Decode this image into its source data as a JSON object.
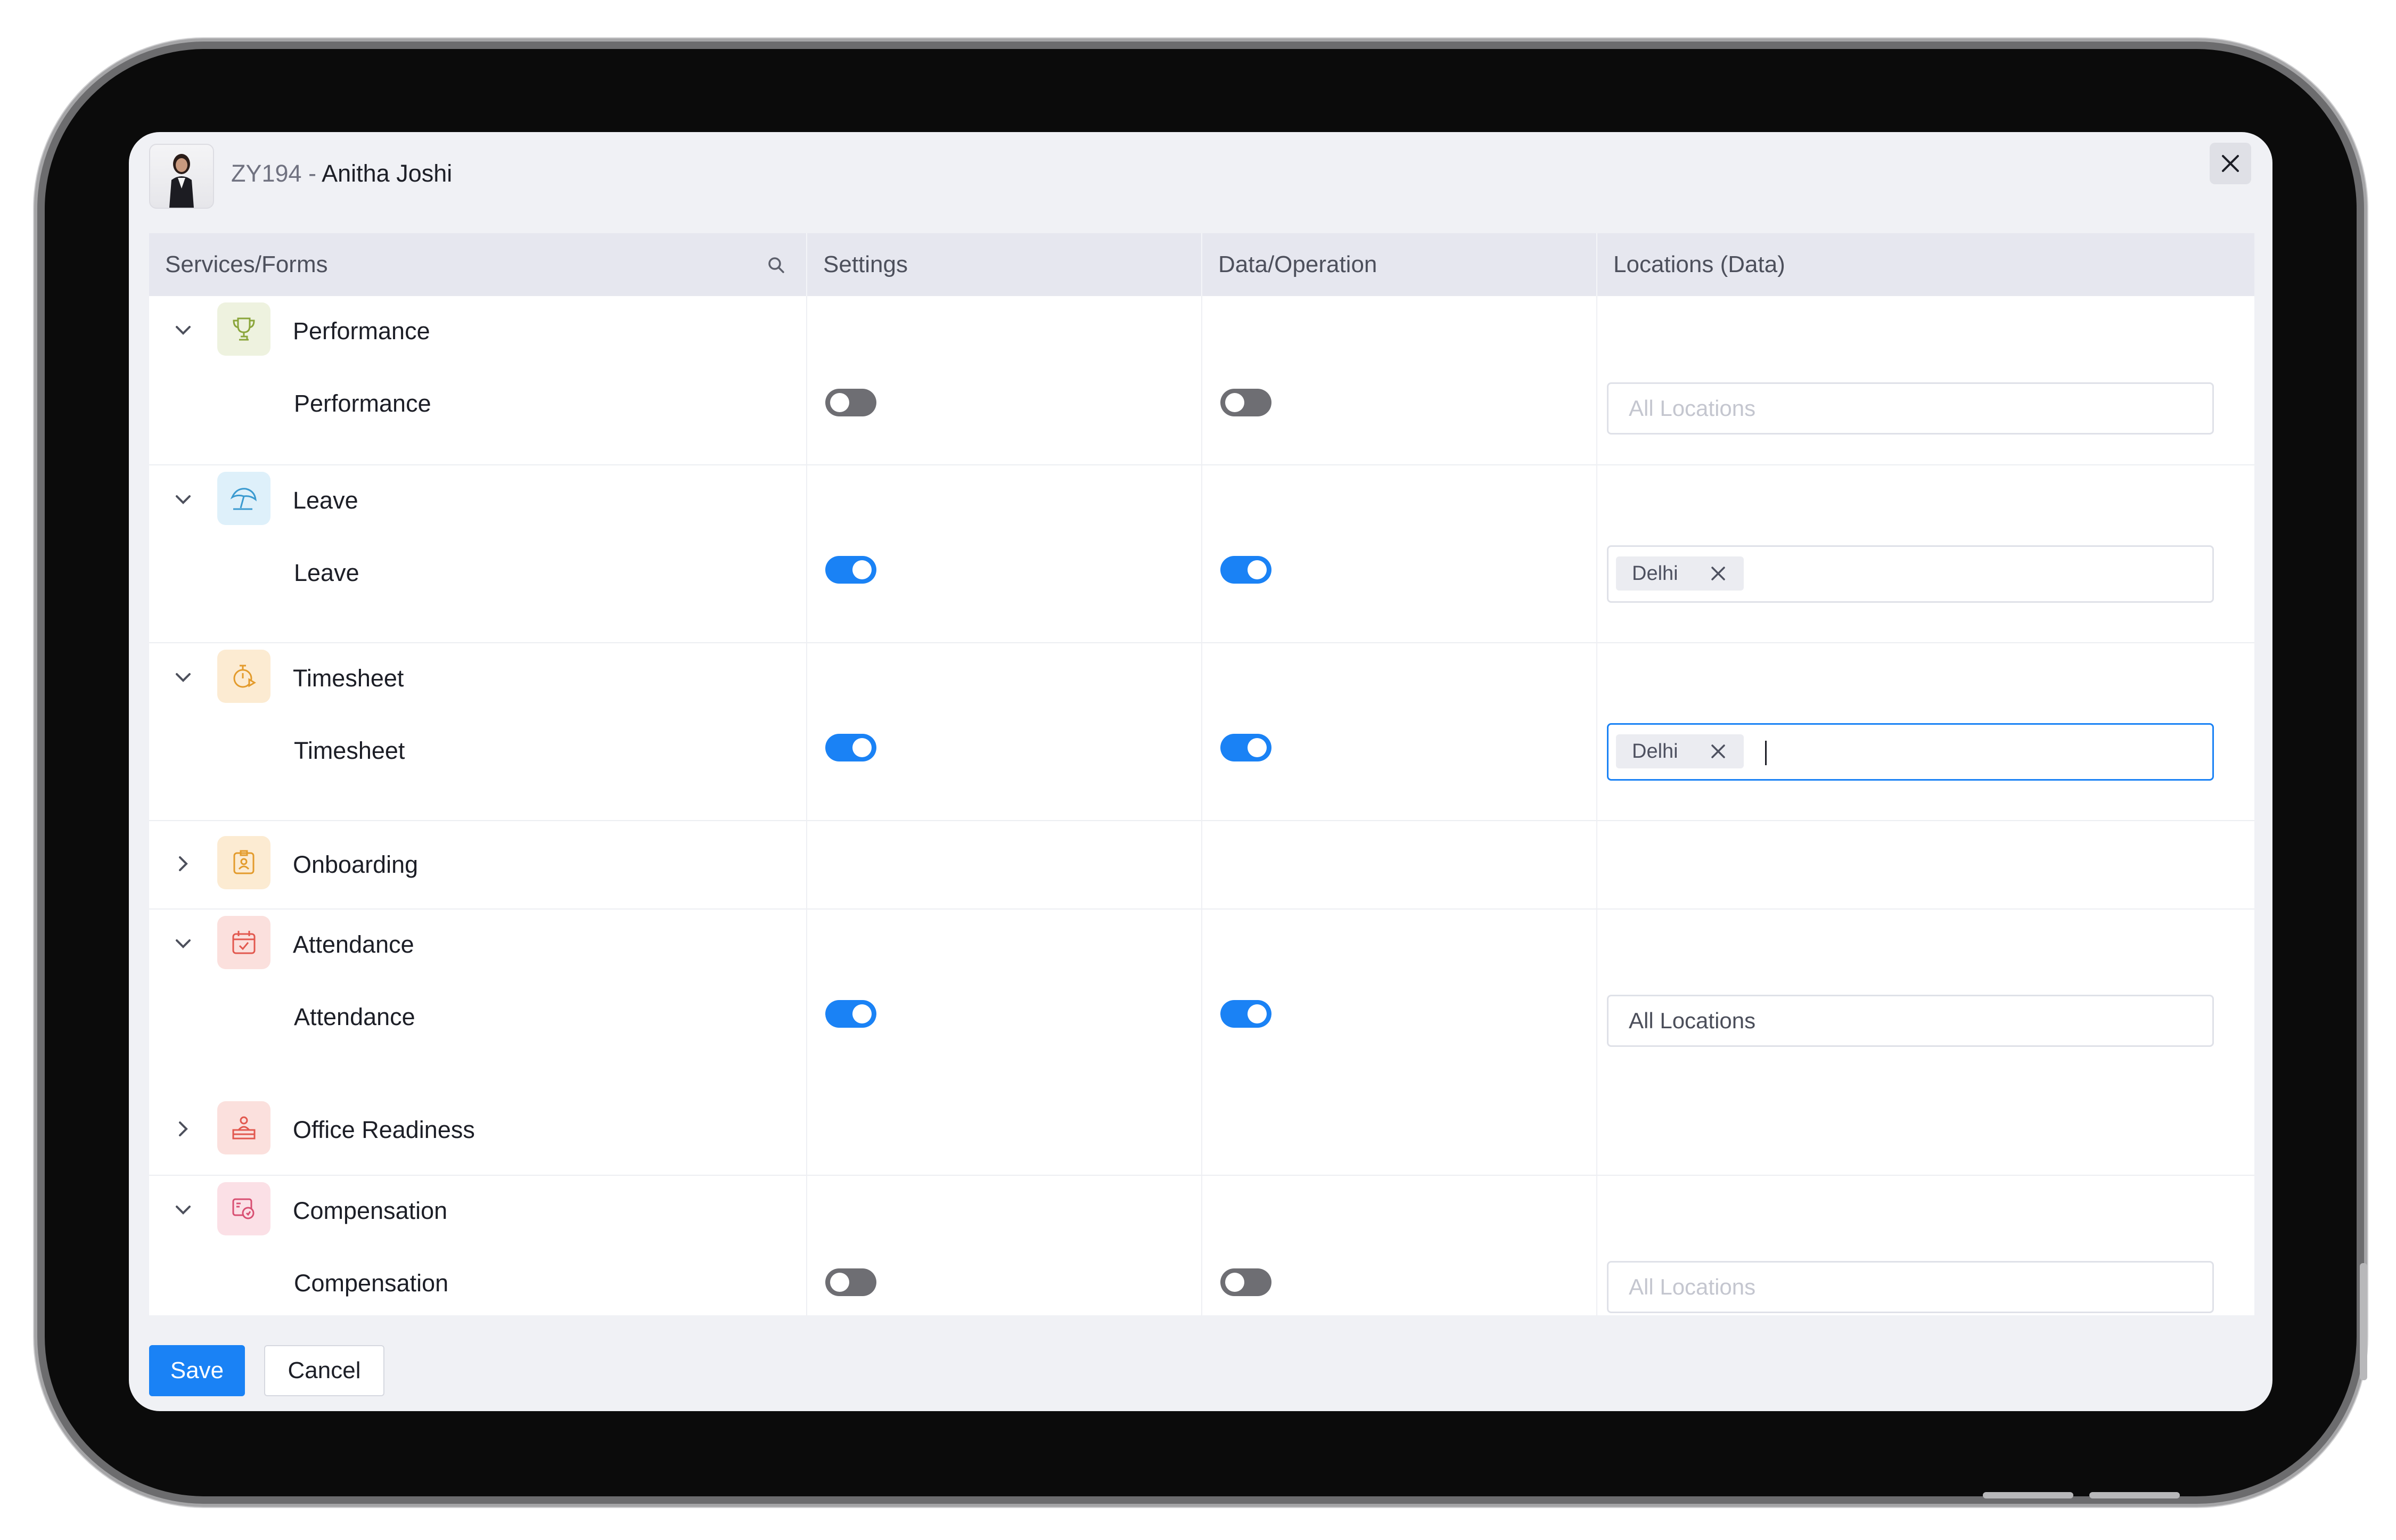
{
  "header": {
    "employee_id": "ZY194 - ",
    "employee_name": "Anitha Joshi"
  },
  "table": {
    "columns": [
      "Services/Forms",
      "Settings",
      "Data/Operation",
      "Locations (Data)"
    ],
    "groups": [
      {
        "label": "Performance",
        "expanded": true,
        "icon": "trophy-icon",
        "color": "#8aa53a",
        "sub": {
          "label": "Performance",
          "settings": false,
          "data": false,
          "location": "All Locations",
          "location_state": "placeholder"
        }
      },
      {
        "label": "Leave",
        "expanded": true,
        "icon": "beach-umbrella-icon",
        "color": "#3a9ad0",
        "sub": {
          "label": "Leave",
          "settings": true,
          "data": true,
          "chip": "Delhi"
        }
      },
      {
        "label": "Timesheet",
        "expanded": true,
        "icon": "timer-icon",
        "color": "#e39b2c",
        "sub": {
          "label": "Timesheet",
          "settings": true,
          "data": true,
          "chip": "Delhi"
        }
      },
      {
        "label": "Onboarding",
        "expanded": false,
        "icon": "id-badge-icon",
        "color": "#e39b2c"
      },
      {
        "label": "Attendance",
        "expanded": true,
        "icon": "calendar-check-icon",
        "color": "#e2584e",
        "sub": {
          "label": "Attendance",
          "settings": true,
          "data": true,
          "location": "All Locations",
          "location_state": "value"
        }
      },
      {
        "label": "Office Readiness",
        "expanded": false,
        "icon": "desk-person-icon",
        "color": "#e2584e"
      },
      {
        "label": "Compensation",
        "expanded": true,
        "icon": "money-icon",
        "color": "#d84f72",
        "sub": {
          "label": "Compensation",
          "settings": false,
          "data": false,
          "location": "All Locations",
          "location_state": "placeholder"
        }
      }
    ]
  },
  "footer": {
    "save_label": "Save",
    "cancel_label": "Cancel"
  },
  "colors": {
    "accent": "#1a82f5",
    "toggle_off": "#6e6e73"
  }
}
